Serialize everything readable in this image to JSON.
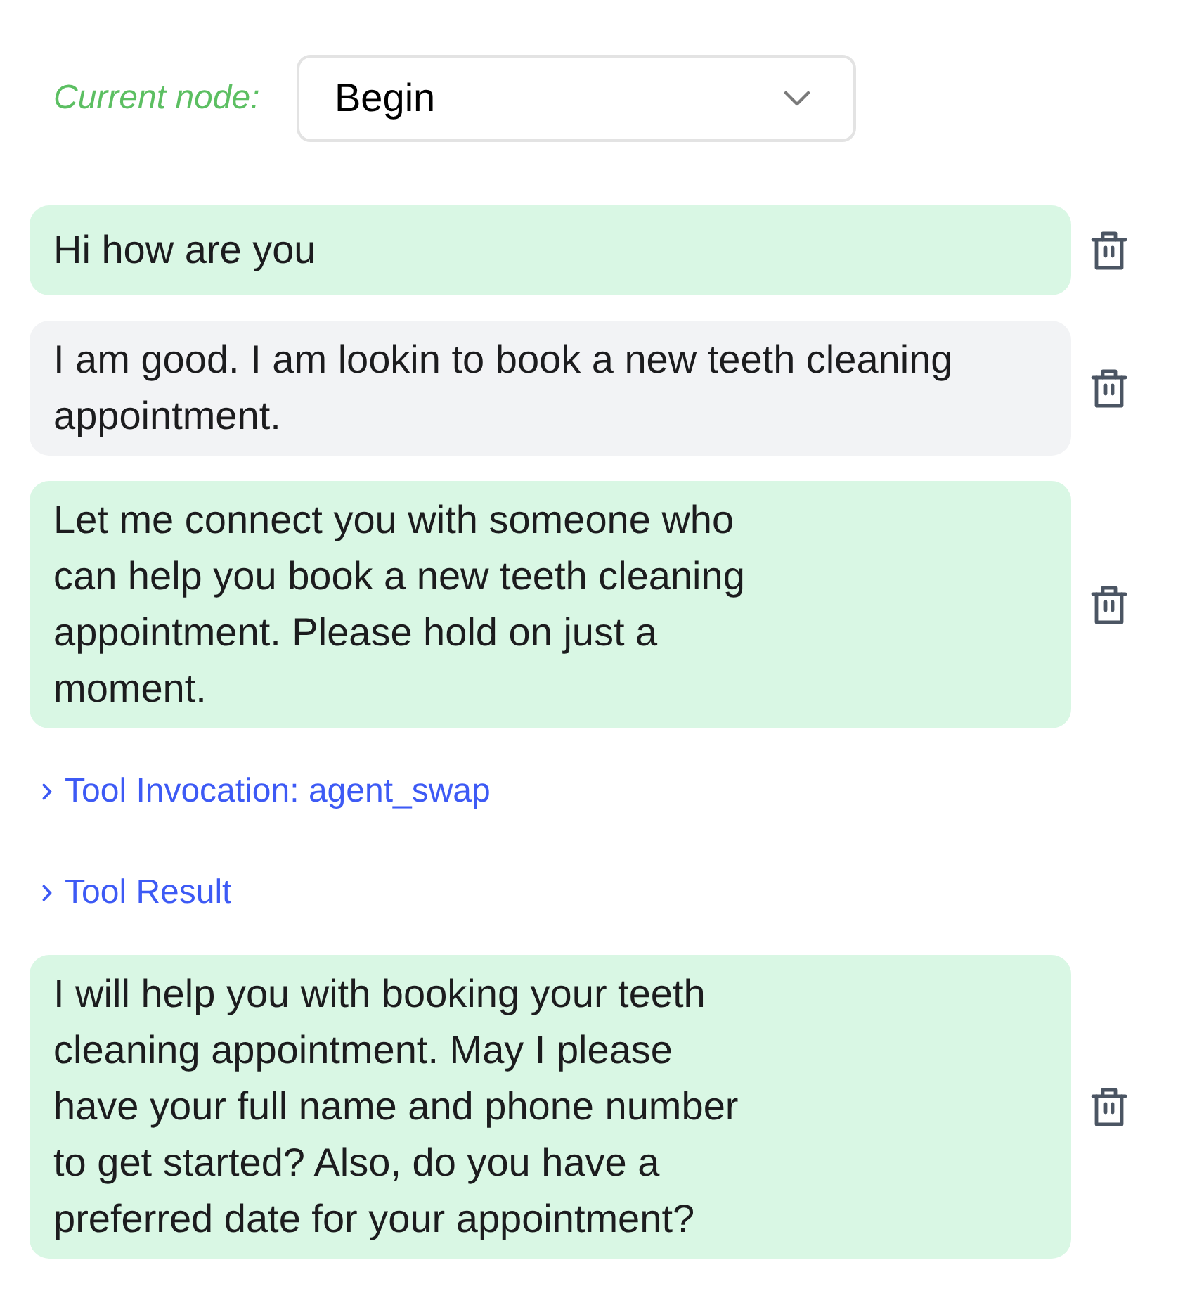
{
  "current_node": {
    "label": "Current node:",
    "value": "Begin"
  },
  "items": [
    {
      "kind": "agent_message",
      "text": "Hi how are you"
    },
    {
      "kind": "user_message",
      "text": "I am good. I am lookin to book a new teeth cleaning appointment."
    },
    {
      "kind": "agent_message",
      "text": "Let me connect you with someone who can help you book a new teeth cleaning appointment. Please hold on just a moment."
    },
    {
      "kind": "tool",
      "label": "Tool Invocation: agent_swap",
      "expanded": false
    },
    {
      "kind": "tool",
      "label": "Tool Result",
      "expanded": false
    },
    {
      "kind": "agent_message",
      "text": "I will help you with booking your teeth cleaning appointment. May I please have your full name and phone number to get started? Also, do you have a preferred date for your appointment?"
    }
  ]
}
